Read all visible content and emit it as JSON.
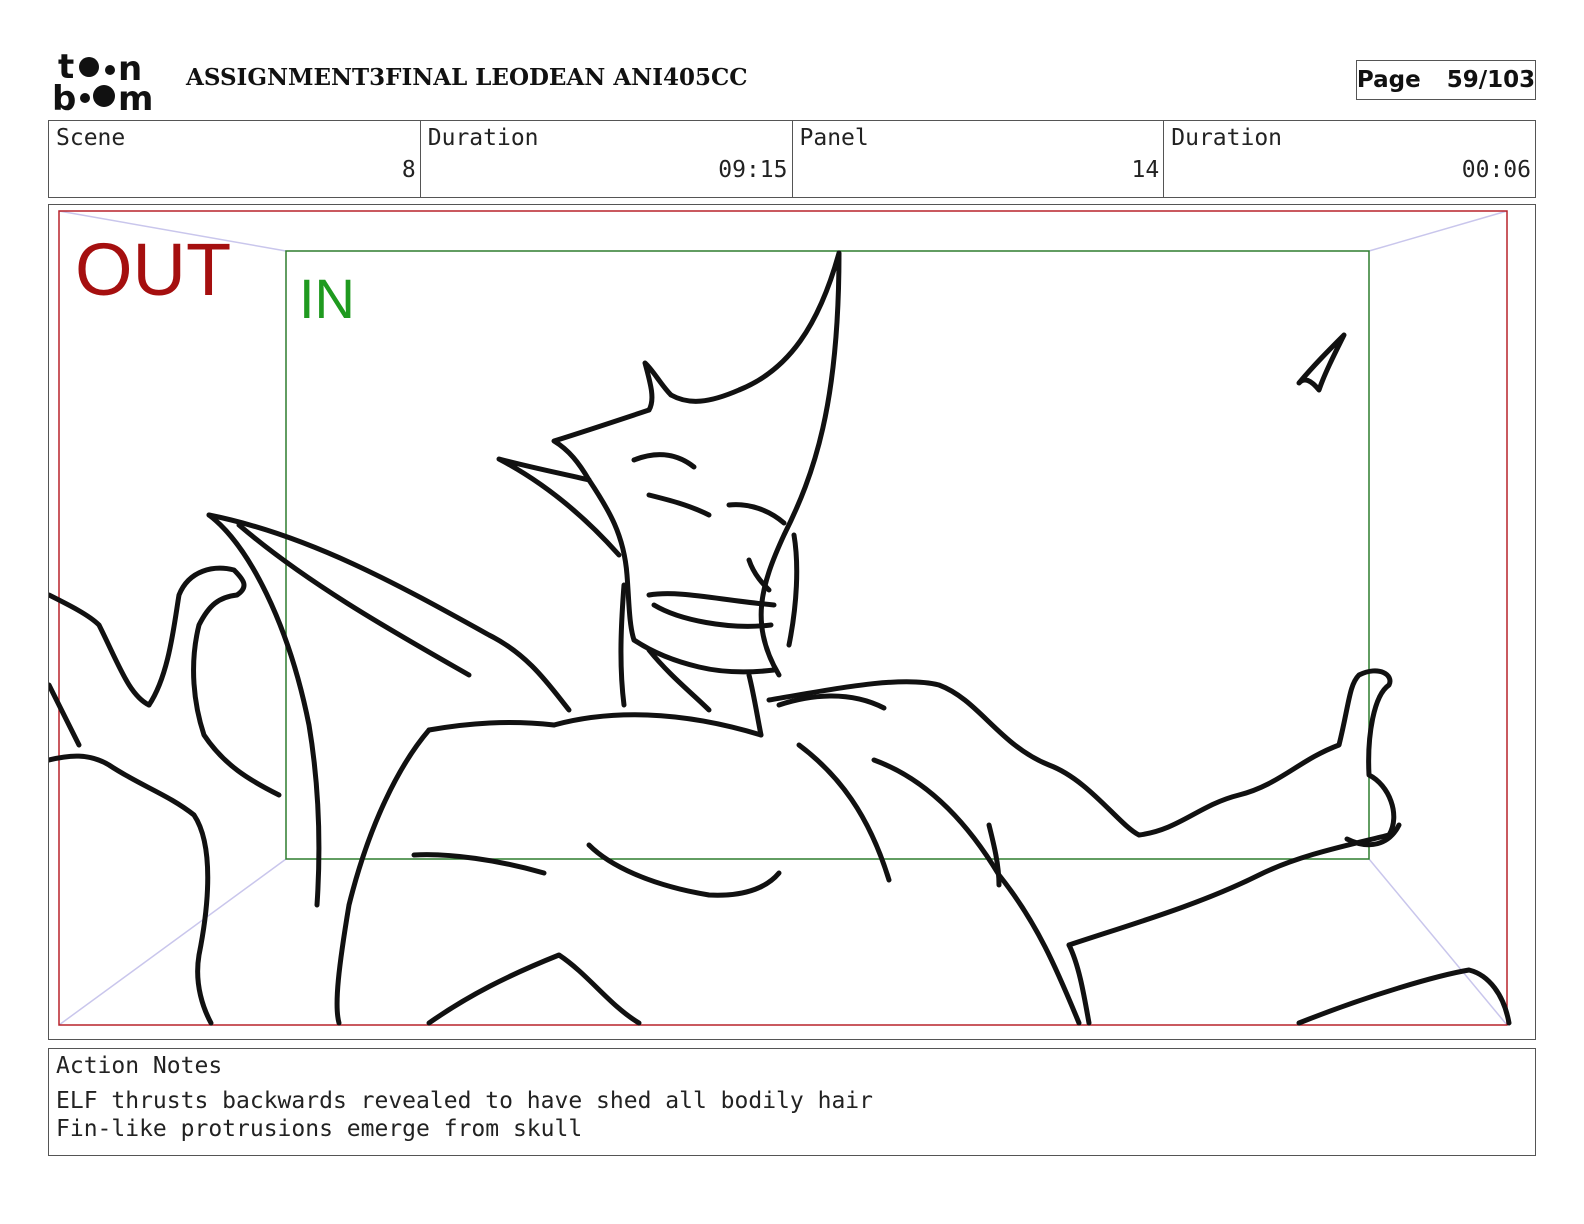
{
  "header": {
    "logo_icon": "toon-boom-logo-icon",
    "project_title": "ASSIGNMENT3FINAL LEODEAN ANI405CC",
    "page_label": "Page",
    "page_value": "59/103"
  },
  "info": {
    "scene_label": "Scene",
    "scene_value": "8",
    "scene_duration_label": "Duration",
    "scene_duration_value": "09:15",
    "panel_label": "Panel",
    "panel_value": "14",
    "panel_duration_label": "Duration",
    "panel_duration_value": "00:06"
  },
  "panel": {
    "out_label": "OUT",
    "in_label": "IN",
    "out_frame_color": "#b8222a",
    "in_frame_color": "#2e7d2e",
    "perspective_line_color": "#c9c6ec"
  },
  "notes": {
    "label": "Action Notes",
    "lines": [
      "ELF thrusts backwards revealed to have shed all bodily hair",
      "Fin-like protrusions emerge from skull"
    ]
  }
}
